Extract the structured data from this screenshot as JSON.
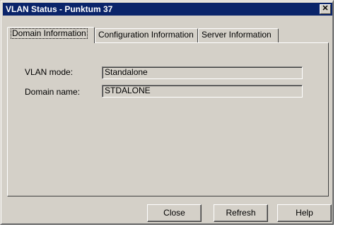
{
  "window": {
    "title": "VLAN Status - Punktum 37",
    "close_glyph": "✕"
  },
  "tabs": [
    {
      "label": "Domain Information",
      "active": true
    },
    {
      "label": "Configuration Information",
      "active": false
    },
    {
      "label": "Server Information",
      "active": false
    }
  ],
  "fields": {
    "vlan_mode": {
      "label": "VLAN mode:",
      "value": "Standalone"
    },
    "domain_name": {
      "label": "Domain name:",
      "value": "STDALONE"
    }
  },
  "buttons": {
    "close": "Close",
    "refresh": "Refresh",
    "help": "Help"
  },
  "colors": {
    "titlebar": "#0a246a",
    "face": "#d4d0c8"
  },
  "icons": {
    "close": "close-icon"
  }
}
